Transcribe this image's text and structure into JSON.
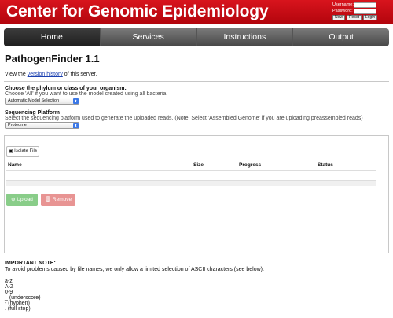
{
  "header": {
    "logo_text": "Center for Genomic Epidemiology",
    "username_label": "Username:",
    "password_label": "Password:",
    "new_label": "New",
    "reset_label": "Reset",
    "login_label": "Login"
  },
  "nav": {
    "items": [
      "Home",
      "Services",
      "Instructions",
      "Output"
    ],
    "active": "Home"
  },
  "page": {
    "title": "PathogenFinder 1.1",
    "version_prefix": "View the",
    "version_link": "version history",
    "version_suffix": "of this server."
  },
  "phylum": {
    "label": "Choose the phylum or class of your organism:",
    "help": "Choose 'All' if you want to use the model created using all bacteria",
    "selected": "Automatic Model Selection"
  },
  "platform": {
    "label": "Sequencing Platform",
    "help": "Select the sequencing platform used to generate the uploaded reads. (Note: Select 'Assembled Genome' if you are uploading preassembled reads)",
    "selected": "Proteome"
  },
  "upload": {
    "isolate_button": "Isolate File",
    "columns": [
      "Name",
      "Size",
      "Progress",
      "Status"
    ],
    "upload_button": "Upload",
    "remove_button": "Remove"
  },
  "note": {
    "heading": "IMPORTANT NOTE:",
    "text": "To avoid problems caused by file names, we only allow a limited selection of ASCII characters (see below).",
    "allowed": [
      "a-z",
      "A-Z",
      "0-9",
      "_ (underscore)",
      "- (hyphen)",
      ". (full stop)"
    ]
  },
  "colors": {
    "header_red": "#c80d16",
    "nav_gray": "#5a5a5a",
    "upload_green": "#89cd89",
    "remove_red": "#e89493",
    "link_blue": "#1a3fb0"
  }
}
